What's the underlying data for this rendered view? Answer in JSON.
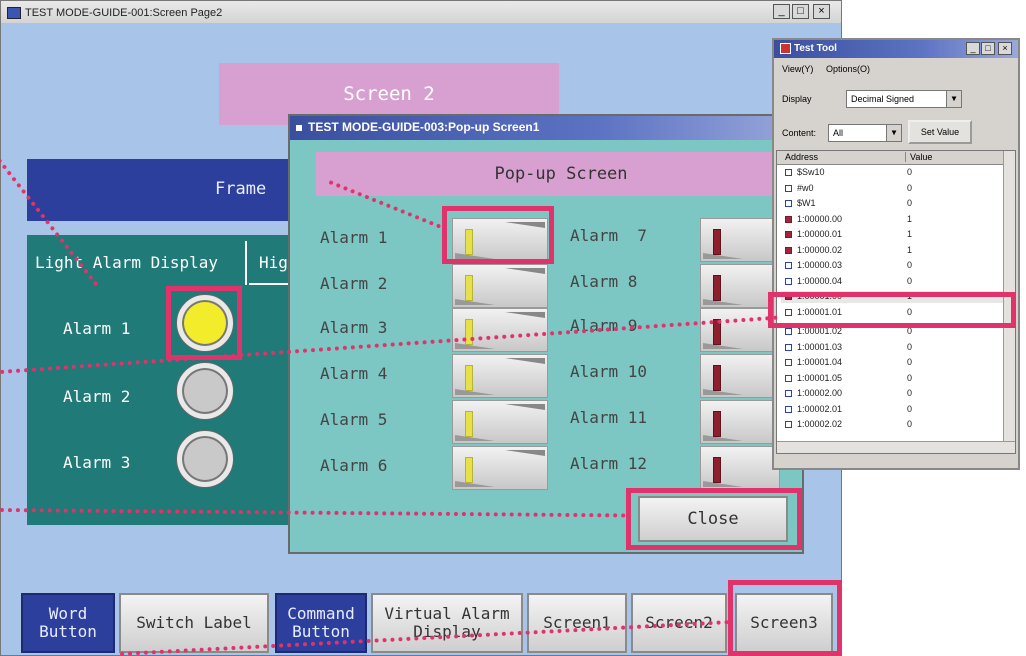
{
  "main_window": {
    "title": "TEST MODE-GUIDE-001:Screen Page2",
    "sys_buttons": [
      "_",
      "□",
      "×"
    ],
    "screen_label": "Screen 2",
    "frame_label": "Frame",
    "tabs": [
      "Light Alarm Display",
      "Hig"
    ],
    "alarms": [
      {
        "label": "Alarm 1",
        "state": "on"
      },
      {
        "label": "Alarm 2",
        "state": "off"
      },
      {
        "label": "Alarm 3",
        "state": "off"
      }
    ],
    "bottom_buttons": [
      {
        "label": "Word\nButton",
        "style": "blue"
      },
      {
        "label": "Switch Label",
        "style": "gray"
      },
      {
        "label": "Command\nButton",
        "style": "blue"
      },
      {
        "label": "Virtual Alarm\nDisplay",
        "style": "gray"
      },
      {
        "label": "Screen1",
        "style": "gray"
      },
      {
        "label": "Screen2",
        "style": "gray"
      },
      {
        "label": "Screen3",
        "style": "gray"
      }
    ]
  },
  "popup": {
    "title": "TEST MODE-GUIDE-003:Pop-up Screen1",
    "header": "Pop-up Screen",
    "left_alarms": [
      "Alarm 1",
      "Alarm 2",
      "Alarm 3",
      "Alarm 4",
      "Alarm 5",
      "Alarm 6"
    ],
    "right_alarms": [
      "Alarm  7",
      "Alarm 8",
      "Alarm 9",
      "Alarm 10",
      "Alarm 11",
      "Alarm 12"
    ],
    "close_label": "Close"
  },
  "test_tool": {
    "title": "Test Tool",
    "menu": [
      "View(Y)",
      "Options(O)"
    ],
    "display_label": "Display",
    "display_value": "Decimal Signed",
    "content_label": "Content:",
    "content_value": "All",
    "set_value_label": "Set Value",
    "col_address": "Address",
    "col_value": "Value",
    "rows": [
      {
        "address": "$Sw10",
        "value": "0",
        "on": false
      },
      {
        "address": "#w0",
        "value": "0",
        "on": false
      },
      {
        "address": "$W1",
        "value": "0",
        "on": false
      },
      {
        "address": "1:00000.00",
        "value": "1",
        "on": true
      },
      {
        "address": "1:00000.01",
        "value": "1",
        "on": true
      },
      {
        "address": "1:00000.02",
        "value": "1",
        "on": true
      },
      {
        "address": "1:00000.03",
        "value": "0",
        "on": false
      },
      {
        "address": "1:00000.04",
        "value": "0",
        "on": false
      },
      {
        "address": "1:00001.00",
        "value": "1",
        "on": true
      },
      {
        "address": "1:00001.01",
        "value": "0",
        "on": false
      },
      {
        "address": "1:00001.02",
        "value": "0",
        "on": false
      },
      {
        "address": "1:00001.03",
        "value": "0",
        "on": false
      },
      {
        "address": "1:00001.04",
        "value": "0",
        "on": false
      },
      {
        "address": "1:00001.05",
        "value": "0",
        "on": false
      },
      {
        "address": "1:00002.00",
        "value": "0",
        "on": false
      },
      {
        "address": "1:00002.01",
        "value": "0",
        "on": false
      },
      {
        "address": "1:00002.02",
        "value": "0",
        "on": false
      }
    ]
  },
  "colors": {
    "highlight": "#e0336b",
    "screen_bg": "#a8c4e8",
    "panel_teal": "#1f7a78",
    "popup_bg": "#7cc6c4",
    "pink_label": "#d7a0d0",
    "navy": "#2d3f9c"
  }
}
